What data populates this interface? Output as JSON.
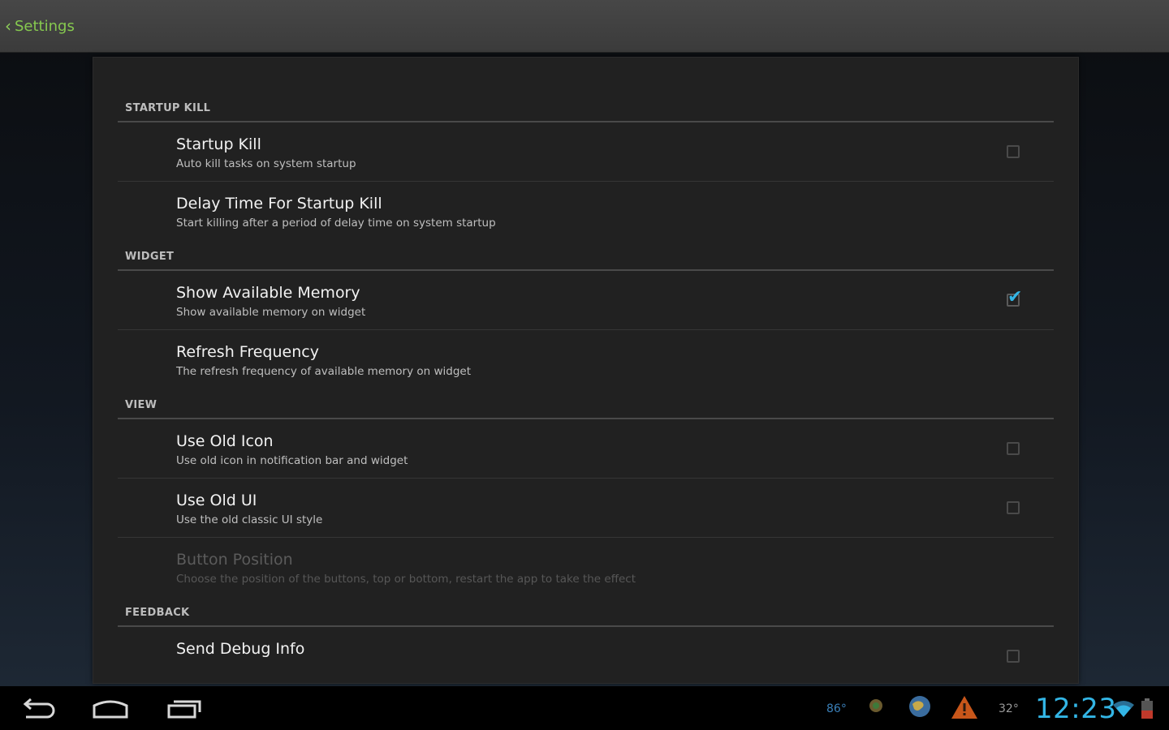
{
  "actionbar": {
    "title": "Settings",
    "up_icon": "chevron-left-icon"
  },
  "sections": [
    {
      "header": "STARTUP KILL",
      "items": [
        {
          "title": "Startup Kill",
          "summary": "Auto kill tasks on system startup",
          "checkbox": true,
          "checked": false
        },
        {
          "title": "Delay Time For Startup Kill",
          "summary": "Start killing after a period of delay time on system startup",
          "checkbox": false
        }
      ]
    },
    {
      "header": "WIDGET",
      "items": [
        {
          "title": "Show Available Memory",
          "summary": "Show available memory on widget",
          "checkbox": true,
          "checked": true
        },
        {
          "title": "Refresh Frequency",
          "summary": "The refresh frequency of available memory on widget",
          "checkbox": false
        }
      ]
    },
    {
      "header": "VIEW",
      "items": [
        {
          "title": "Use Old Icon",
          "summary": "Use old icon in notification bar and widget",
          "checkbox": true,
          "checked": false
        },
        {
          "title": "Use Old UI",
          "summary": "Use the old classic UI style",
          "checkbox": true,
          "checked": false
        },
        {
          "title": "Button Position",
          "summary": "Choose the position of the buttons, top or bottom, restart the app to take the effect",
          "checkbox": false,
          "disabled": true
        }
      ]
    },
    {
      "header": "FEEDBACK",
      "items": [
        {
          "title": "Send Debug Info",
          "summary": "",
          "checkbox": true,
          "checked": false
        }
      ]
    }
  ],
  "statusbar": {
    "time": "12:23",
    "left_temp": "86°",
    "right_temp": "32°",
    "accent": "#33b5e5",
    "icons": [
      "weather-icon",
      "android-icon",
      "globe-icon",
      "warning-icon",
      "wifi-icon",
      "battery-icon"
    ]
  },
  "navbar": {
    "buttons": [
      "back-icon",
      "home-icon",
      "recent-apps-icon"
    ]
  }
}
